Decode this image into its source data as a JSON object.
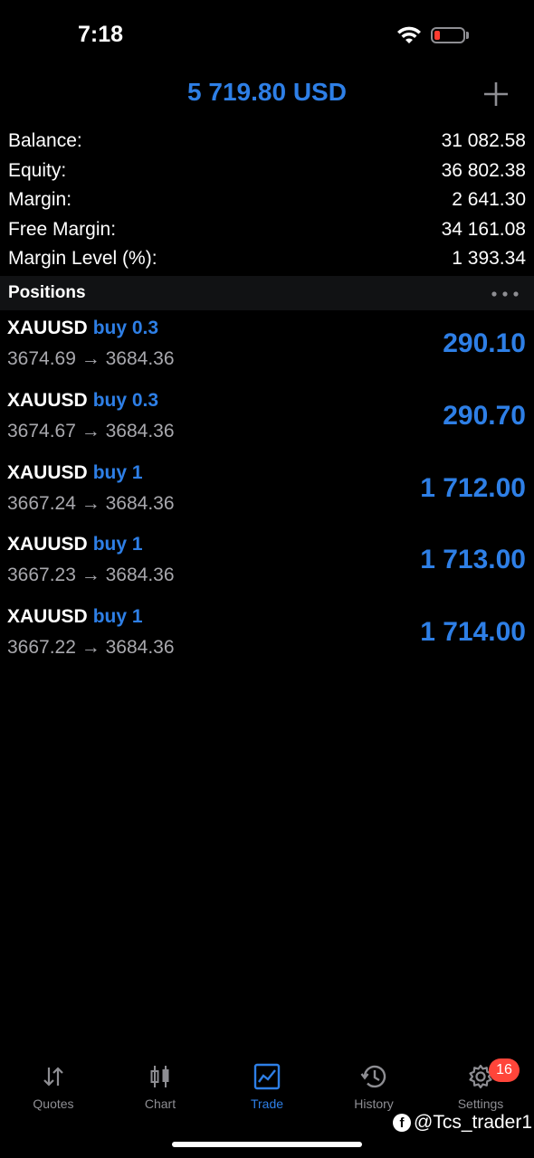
{
  "status_bar": {
    "time": "7:18",
    "battery_level": 0.2,
    "battery_color": "#ff3b30"
  },
  "header": {
    "title": "5 719.80 USD",
    "add_icon": "plus-icon"
  },
  "summary": [
    {
      "label": "Balance:",
      "value": "31 082.58"
    },
    {
      "label": "Equity:",
      "value": "36 802.38"
    },
    {
      "label": "Margin:",
      "value": "2 641.30"
    },
    {
      "label": "Free Margin:",
      "value": "34 161.08"
    },
    {
      "label": "Margin Level (%):",
      "value": "1 393.34"
    }
  ],
  "positions": {
    "title": "Positions",
    "menu_icon": "more-horizontal-icon",
    "items": [
      {
        "symbol": "XAUUSD",
        "direction": "buy 0.3",
        "open_price": "3674.69",
        "arrow": "→",
        "current_price": "3684.36",
        "profit": "290.10"
      },
      {
        "symbol": "XAUUSD",
        "direction": "buy 0.3",
        "open_price": "3674.67",
        "arrow": "→",
        "current_price": "3684.36",
        "profit": "290.70"
      },
      {
        "symbol": "XAUUSD",
        "direction": "buy 1",
        "open_price": "3667.24",
        "arrow": "→",
        "current_price": "3684.36",
        "profit": "1 712.00"
      },
      {
        "symbol": "XAUUSD",
        "direction": "buy 1",
        "open_price": "3667.23",
        "arrow": "→",
        "current_price": "3684.36",
        "profit": "1 713.00"
      },
      {
        "symbol": "XAUUSD",
        "direction": "buy 1",
        "open_price": "3667.22",
        "arrow": "→",
        "current_price": "3684.36",
        "profit": "1 714.00"
      }
    ]
  },
  "tabs": [
    {
      "label": "Quotes",
      "icon": "quotes-arrows-icon",
      "active": false
    },
    {
      "label": "Chart",
      "icon": "candlestick-chart-icon",
      "active": false
    },
    {
      "label": "Trade",
      "icon": "trade-line-chart-icon",
      "active": true
    },
    {
      "label": "History",
      "icon": "history-clock-icon",
      "active": false
    },
    {
      "label": "Settings",
      "icon": "gear-icon",
      "active": false,
      "badge": "16"
    }
  ],
  "watermark": {
    "text": "@Tcs_trader1",
    "icon": "facebook-icon"
  },
  "colors": {
    "accent": "#2e7fe6",
    "badge": "#ff453a",
    "background": "#000000"
  }
}
